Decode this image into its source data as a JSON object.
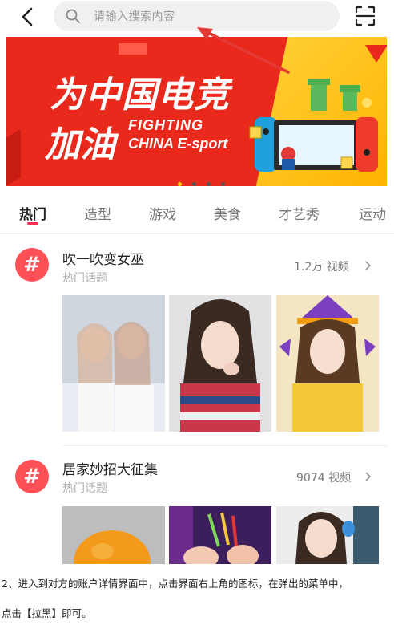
{
  "topbar": {
    "back_icon": "chevron-left-icon",
    "search_placeholder": "请输入搜索内容",
    "scan_icon": "scan-icon"
  },
  "banner": {
    "headline_line1": "为中国电竞",
    "headline_line2": "加油",
    "english_line1": "FIGHTING",
    "english_line2": "CHINA E-sport",
    "colors": {
      "red": "#e8291b",
      "yellow": "#ffcc00"
    },
    "pagination_count": 4,
    "pagination_active": 1
  },
  "tabs": [
    {
      "label": "热门",
      "active": true
    },
    {
      "label": "造型",
      "active": false
    },
    {
      "label": "游戏",
      "active": false
    },
    {
      "label": "美食",
      "active": false
    },
    {
      "label": "才艺秀",
      "active": false
    },
    {
      "label": "运动",
      "active": false
    }
  ],
  "topics": [
    {
      "title": "吹一吹变女巫",
      "subtitle": "热门话题",
      "count": "1.2万 视频",
      "thumbnails": [
        "two-women-selfie",
        "woman-peace-sign",
        "woman-witch-hat"
      ]
    },
    {
      "title": "居家妙招大征集",
      "subtitle": "热门话题",
      "count": "9074 视频",
      "thumbnails": [
        "orange-fruit",
        "clips-hands",
        "woman-hair-tie"
      ]
    }
  ],
  "article": {
    "line1": "2、进入到对方的账户详情界面中，点击界面右上角的图标，在弹出的菜单中，",
    "line2": "点击【拉黑】即可。"
  },
  "accent_color": "#fe2c55"
}
